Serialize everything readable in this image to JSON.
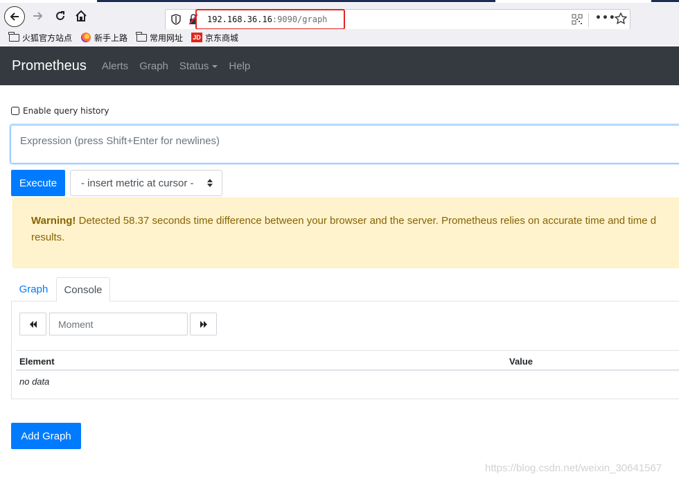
{
  "browser": {
    "url_host": "192.168.36.16",
    "url_rest": ":9090/graph",
    "bookmarks": [
      {
        "label": "火狐官方站点",
        "icon": "folder-icon"
      },
      {
        "label": "新手上路",
        "icon": "firefox-icon"
      },
      {
        "label": "常用网址",
        "icon": "folder-icon"
      },
      {
        "label": "京东商城",
        "icon": "jd-icon"
      }
    ],
    "jd_badge": "JD"
  },
  "navbar": {
    "brand": "Prometheus",
    "links": [
      "Alerts",
      "Graph",
      "Status",
      "Help"
    ]
  },
  "main": {
    "history_label": "Enable query history",
    "expression_placeholder": "Expression (press Shift+Enter for newlines)",
    "execute_label": "Execute",
    "metric_select": "- insert metric at cursor -",
    "warning": {
      "strong": "Warning!",
      "text": " Detected 58.37 seconds time difference between your browser and the server. Prometheus relies on accurate time and time d",
      "line2": "results."
    },
    "tabs": [
      "Graph",
      "Console"
    ],
    "active_tab": "Console",
    "moment_placeholder": "Moment",
    "table": {
      "headers": [
        "Element",
        "Value"
      ],
      "empty": "no data"
    },
    "add_graph_label": "Add Graph"
  },
  "watermark": "https://blog.csdn.net/weixin_30641567"
}
